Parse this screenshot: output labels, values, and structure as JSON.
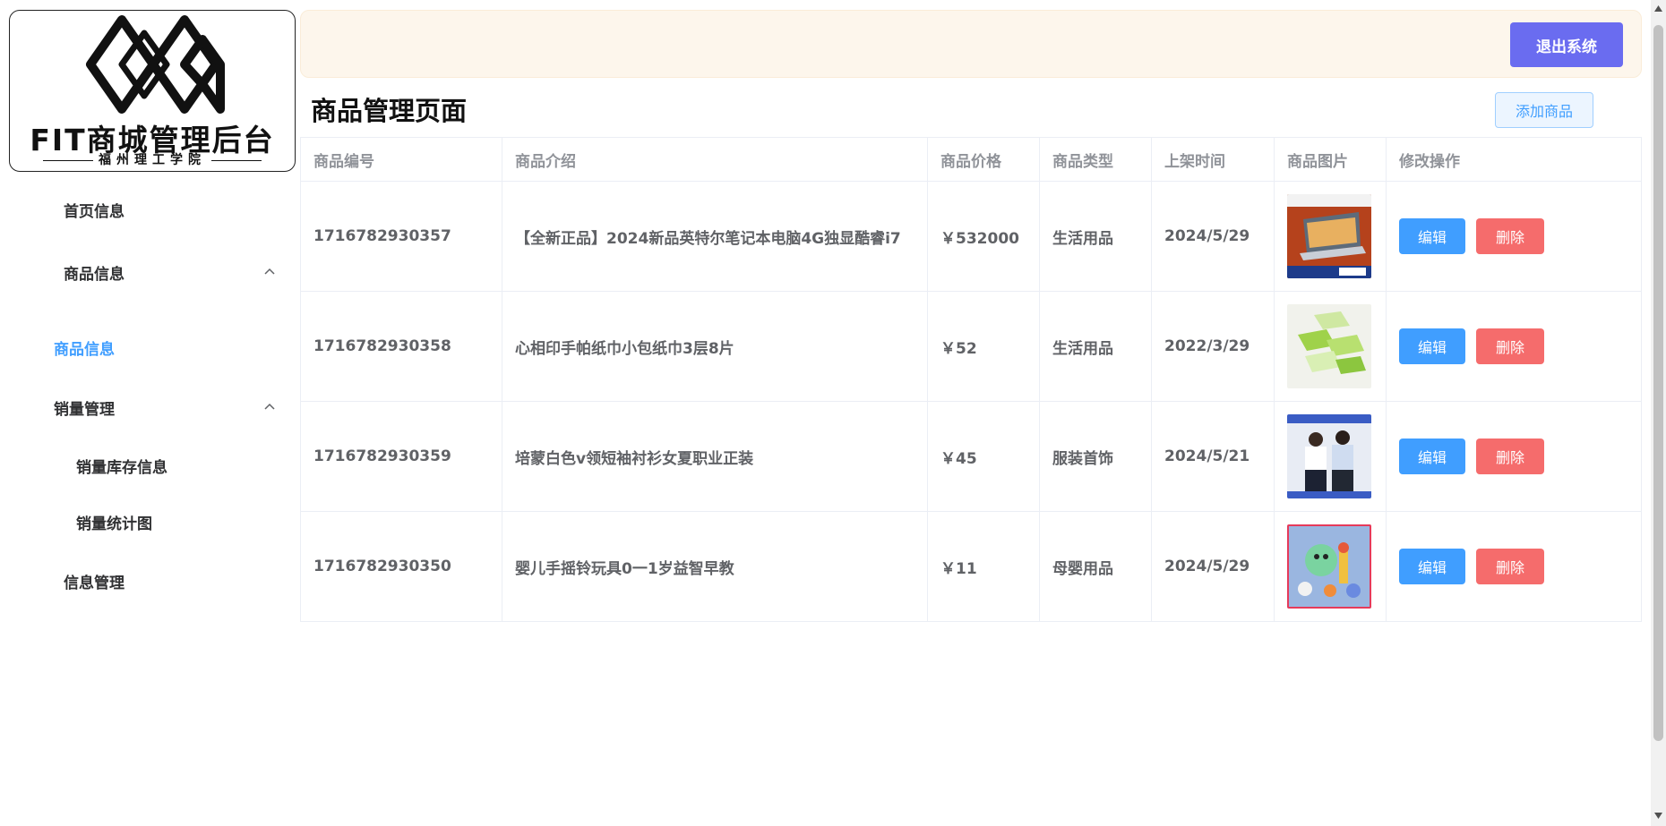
{
  "logo": {
    "title": "FIT商城管理后台",
    "subtitle": "福州理工学院"
  },
  "sidebar": {
    "items": [
      {
        "label": "首页信息",
        "level": 1,
        "active": false
      },
      {
        "label": "商品信息",
        "level": 1,
        "expanded": true,
        "active": false
      },
      {
        "label": "商品信息",
        "level": 2,
        "active": true
      },
      {
        "label": "销量管理",
        "level": 2,
        "expanded": true,
        "active": false
      },
      {
        "label": "销量库存信息",
        "level": 3,
        "active": false
      },
      {
        "label": "销量统计图",
        "level": 3,
        "active": false
      },
      {
        "label": "信息管理",
        "level": 1,
        "active": false
      }
    ]
  },
  "header": {
    "logout_label": "退出系统"
  },
  "main": {
    "title": "商品管理页面",
    "add_label": "添加商品",
    "columns": [
      "商品编号",
      "商品介绍",
      "商品价格",
      "商品类型",
      "上架时间",
      "商品图片",
      "修改操作"
    ],
    "rows": [
      {
        "id": "1716782930357",
        "desc": "【全新正品】2024新品英特尔笔记本电脑4G独显酷睿i7",
        "price": "￥532000",
        "type": "生活用品",
        "date": "2024/5/29",
        "image": "laptop-product-image"
      },
      {
        "id": "1716782930358",
        "desc": "心相印手帕纸巾小包纸巾3层8片",
        "price": "￥52",
        "type": "生活用品",
        "date": "2022/3/29",
        "image": "tissue-product-image"
      },
      {
        "id": "1716782930359",
        "desc": "培蒙白色v领短袖衬衫女夏职业正装",
        "price": "￥45",
        "type": "服装首饰",
        "date": "2024/5/21",
        "image": "shirt-product-image"
      },
      {
        "id": "1716782930350",
        "desc": "婴儿手摇铃玩具0一1岁益智早教",
        "price": "￥11",
        "type": "母婴用品",
        "date": "2024/5/29",
        "image": "toy-product-image"
      }
    ],
    "edit_label": "编辑",
    "delete_label": "删除"
  },
  "colors": {
    "accent": "#409eff",
    "danger": "#f56c6c",
    "logout": "#6a6cf0",
    "header_bg": "#fdf6ec"
  }
}
